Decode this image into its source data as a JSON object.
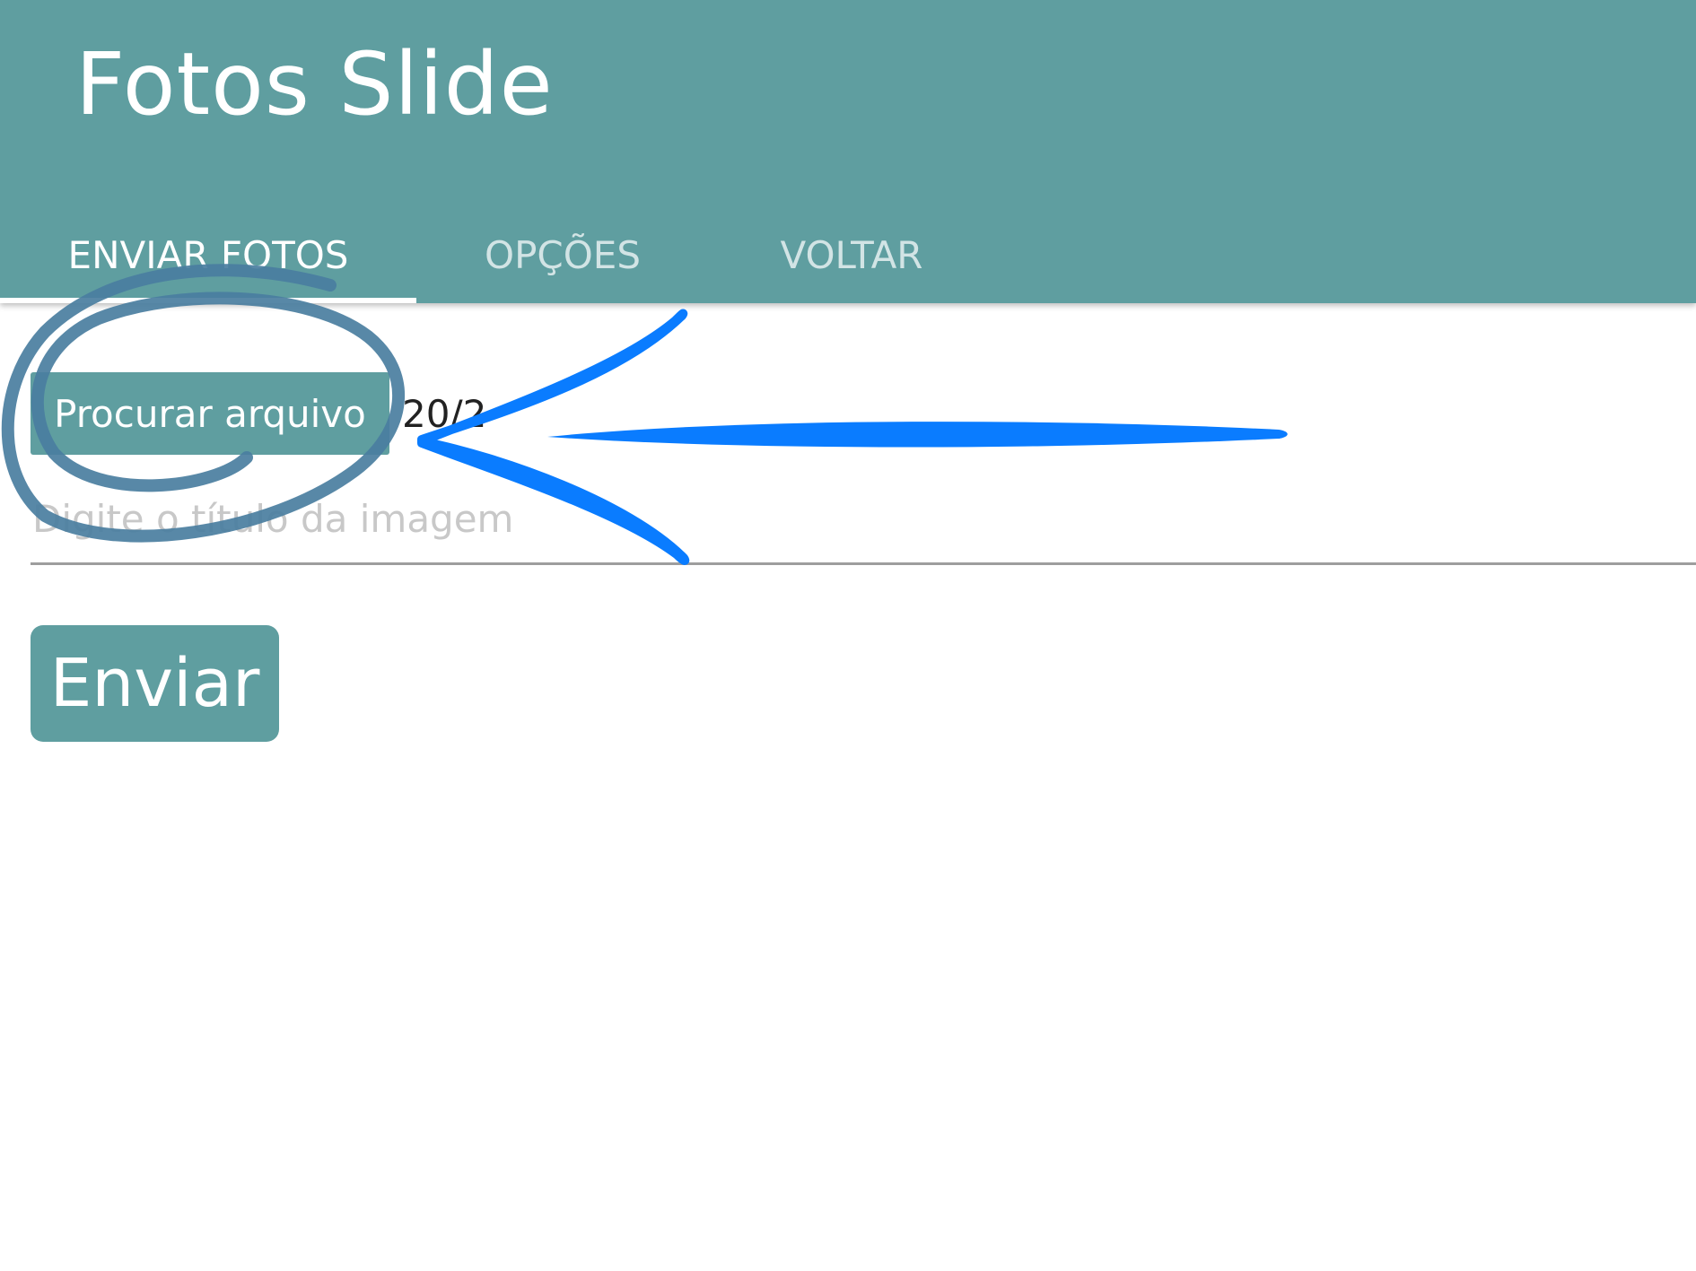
{
  "header": {
    "title": "Fotos Slide",
    "background_color": "#5f9ea0"
  },
  "tabs": [
    {
      "label": "ENVIAR FOTOS",
      "active": true
    },
    {
      "label": "OPÇÕES",
      "active": false
    },
    {
      "label": "VOLTAR",
      "active": false
    }
  ],
  "upload": {
    "browse_label": "Procurar arquivo",
    "file_name": "20/2"
  },
  "title_field": {
    "placeholder": "Digite o título da imagem",
    "value": ""
  },
  "submit": {
    "label": "Enviar"
  },
  "annotations": {
    "circle_color": "#4a7ea0",
    "arrow_color": "#0a7cff"
  }
}
